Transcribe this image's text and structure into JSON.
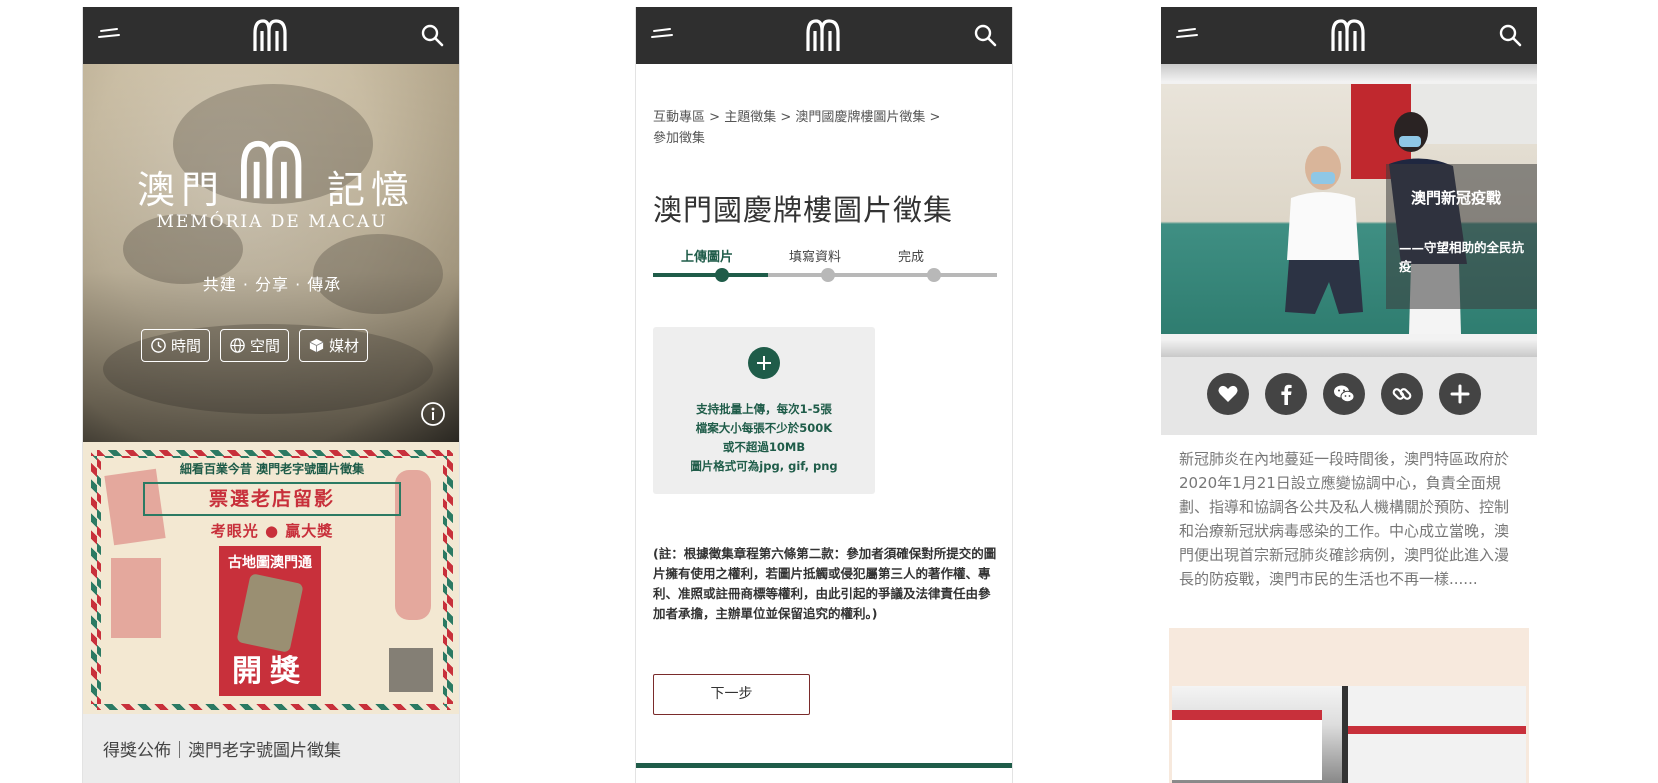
{
  "phone1": {
    "hero": {
      "title_left": "澳門",
      "title_right": "記憶",
      "subtitle": "MEMÓRIA DE MACAU",
      "slogan": "共建 · 分享 · 傳承",
      "buttons": [
        {
          "label": "時間",
          "icon": "clock-icon"
        },
        {
          "label": "空間",
          "icon": "globe-icon"
        },
        {
          "label": "媒材",
          "icon": "cube-icon"
        }
      ]
    },
    "poster": {
      "line1": "細看百業今昔 澳門老字號圖片徵集",
      "line2": "票選老店留影",
      "line3": "考眼光 ● 贏大獎",
      "card_title": "古地圖澳門通",
      "card_prize": "開獎"
    },
    "caption": "得獎公佈｜澳門老字號圖片徵集"
  },
  "phone2": {
    "breadcrumb": [
      "互動專區",
      "主題徵集",
      "澳門國慶牌樓圖片徵集",
      "參加徵集"
    ],
    "title": "澳門國慶牌樓圖片徵集",
    "steps": [
      {
        "label": "上傳圖片",
        "active": true
      },
      {
        "label": "填寫資料",
        "active": false
      },
      {
        "label": "完成",
        "active": false
      }
    ],
    "upload": {
      "lines": [
        "支持批量上傳，每次1-5張",
        "檔案大小每張不少於500K",
        "或不超過10MB",
        "圖片格式可為jpg, gif, png"
      ]
    },
    "note": "(註：根據徵集章程第六條第二款：參加者須確保對所提交的圖片擁有使用之權利，若圖片抵觸或侵犯屬第三人的著作權、專利、准照或註冊商標等權利，由此引起的爭議及法律責任由參加者承擔，主辦單位並保留追究的權利。)",
    "next_label": "下一步"
  },
  "phone3": {
    "overlay_title": "澳門新冠疫戰",
    "overlay_sub": "——守望相助的全民抗疫",
    "share": [
      "heart-icon",
      "facebook-icon",
      "wechat-icon",
      "link-icon",
      "plus-icon"
    ],
    "article": "新冠肺炎在內地蔓延一段時間後，澳門特區政府於2020年1月21日設立應變協調中心，負責全面規劃、指導和協調各公共及私人機構關於預防、控制和治療新冠狀病毒感染的工作。中心成立當晚，澳門便出現首宗新冠肺炎確診病例，澳門從此進入漫長的防疫戰，澳門市民的生活也不再一樣......"
  },
  "colors": {
    "topbar": "#2f2f2f",
    "accent_green": "#1f5c49",
    "accent_red": "#c8303b"
  }
}
